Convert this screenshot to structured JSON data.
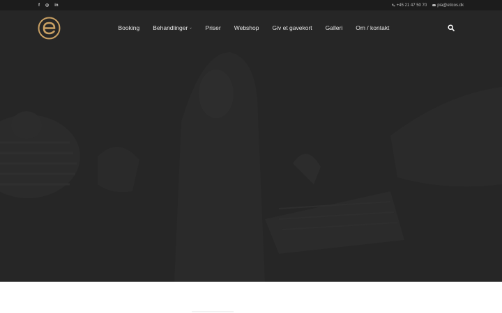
{
  "topbar": {
    "social": [
      {
        "icon": "facebook-icon",
        "glyph": "f"
      },
      {
        "icon": "instagram-icon",
        "glyph": "◎"
      },
      {
        "icon": "linkedin-icon",
        "glyph": "in"
      }
    ],
    "phone": "+45 21 47 50 70",
    "email": "pia@eticos.dk"
  },
  "nav": {
    "logo_letter": "e",
    "items": [
      {
        "label": "Booking",
        "has_dropdown": false
      },
      {
        "label": "Behandlinger",
        "has_dropdown": true
      },
      {
        "label": "Priser",
        "has_dropdown": false
      },
      {
        "label": "Webshop",
        "has_dropdown": false
      },
      {
        "label": "Giv et gavekort",
        "has_dropdown": false
      },
      {
        "label": "Galleri",
        "has_dropdown": false
      },
      {
        "label": "Om / kontakt",
        "has_dropdown": false
      }
    ],
    "search_icon": "search-icon"
  },
  "colors": {
    "topbar_bg": "#1c1c1c",
    "hero_overlay": "#262626",
    "logo_gold": "#c9a063",
    "nav_text": "#e6e6e6"
  }
}
